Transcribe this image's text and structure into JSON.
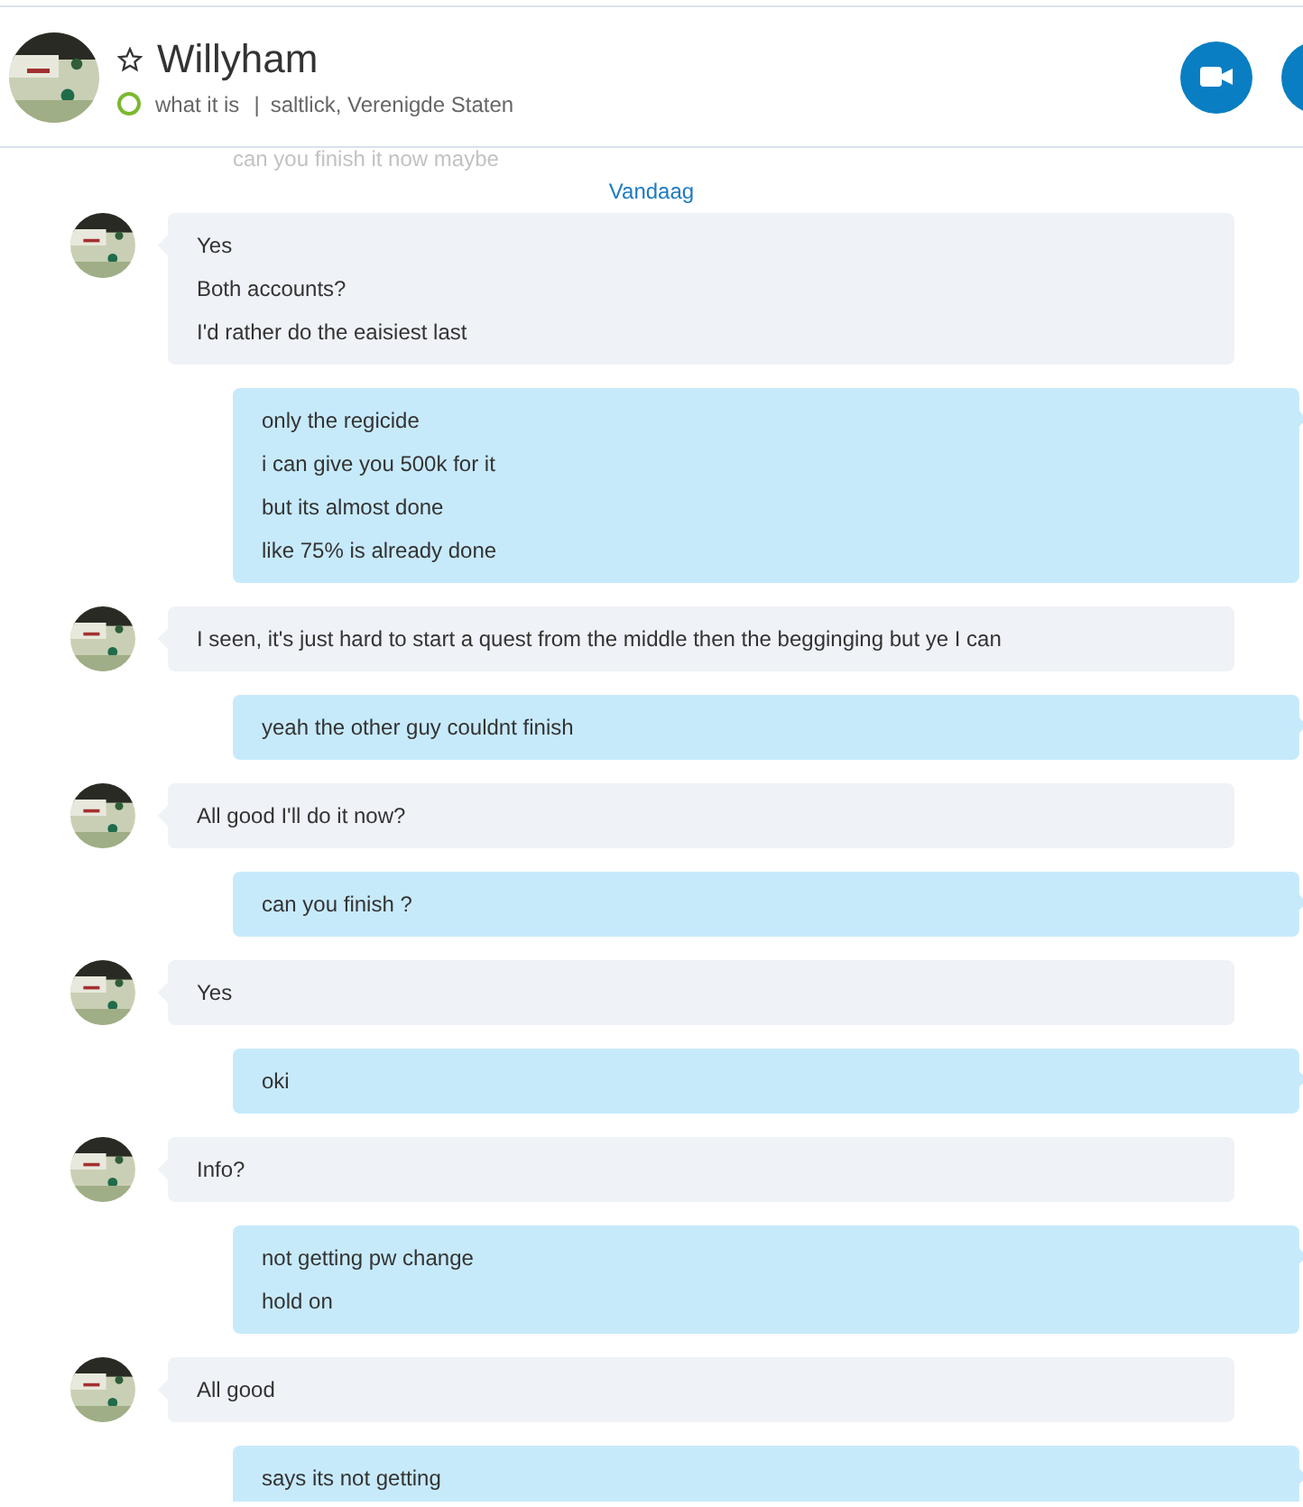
{
  "header": {
    "favorite": false,
    "name": "Willyham",
    "mood": "what it is",
    "separator": "|",
    "location": "saltlick, Verenigde Staten"
  },
  "faded_message": "can you finish it now maybe",
  "date_divider": "Vandaag",
  "messages": [
    {
      "kind": "incoming",
      "lines": [
        "Yes",
        "Both accounts?",
        "I'd rather do the eaisiest last"
      ]
    },
    {
      "kind": "outgoing",
      "lines": [
        "only the regicide",
        "i can give you 500k for it",
        "but its almost done",
        "like 75% is already done"
      ]
    },
    {
      "kind": "incoming",
      "lines": [
        "I seen, it's just hard to start a quest from the middle then the begginging but ye I can"
      ]
    },
    {
      "kind": "outgoing",
      "lines": [
        "yeah the other guy couldnt finish"
      ]
    },
    {
      "kind": "incoming",
      "lines": [
        "All good I'll do it now?"
      ]
    },
    {
      "kind": "outgoing",
      "lines": [
        "can you finish ?"
      ]
    },
    {
      "kind": "incoming",
      "lines": [
        "Yes"
      ]
    },
    {
      "kind": "outgoing",
      "lines": [
        "oki"
      ]
    },
    {
      "kind": "incoming",
      "lines": [
        "Info?"
      ]
    },
    {
      "kind": "outgoing",
      "lines": [
        "not getting pw change",
        "hold on"
      ]
    },
    {
      "kind": "incoming",
      "lines": [
        "All good"
      ]
    },
    {
      "kind": "outgoing",
      "lines": [
        "says its not getting"
      ]
    }
  ]
}
